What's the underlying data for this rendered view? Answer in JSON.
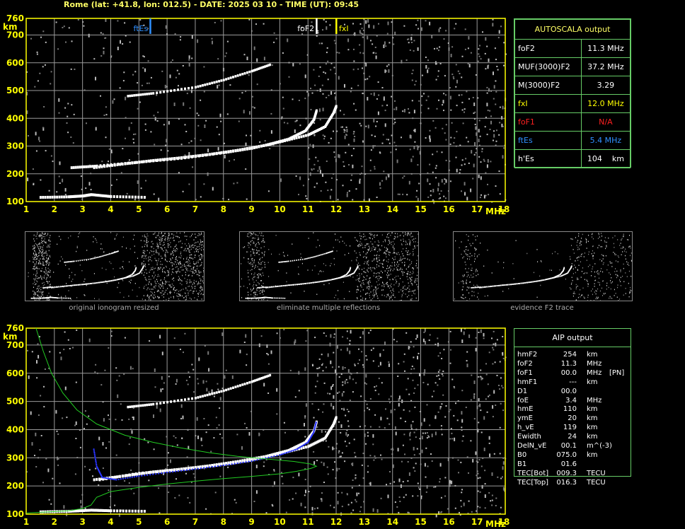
{
  "header": {
    "title": "Rome (lat: +41.8, lon: 012.5) - DATE: 2025 03 10 - TIME (UT): 09:45"
  },
  "colors": {
    "axis": "#ffff00",
    "grid": "#9a9a9a",
    "green_box": "#66cc66",
    "fxI": "#ffff00",
    "foF1": "#ff2020",
    "ftEs": "#3090ff",
    "trace_white": "#ffffff",
    "fit_blue": "#2a35ff",
    "profile_green": "#22cc22"
  },
  "chart_data": [
    {
      "type": "scatter",
      "id": "ionogram-top",
      "xlabel": "MHz",
      "ylabel": "km",
      "xlim": [
        1,
        18
      ],
      "ylim": [
        100,
        760
      ],
      "x_ticks": [
        "1",
        "2",
        "3",
        "4",
        "5",
        "6",
        "7",
        "8",
        "9",
        "10",
        "11",
        "12",
        "13",
        "14",
        "15",
        "16",
        "17",
        "18"
      ],
      "y_ticks": [
        "100",
        "200",
        "300",
        "400",
        "500",
        "600",
        "700",
        "760"
      ],
      "markers": [
        {
          "label": "ftEs",
          "x": 5.4,
          "color_key": "ftEs"
        },
        {
          "label": "foF2",
          "x": 11.3,
          "color_key": "trace_white"
        },
        {
          "label": "fxI",
          "x": 12.0,
          "color_key": "fxI"
        }
      ],
      "traces": [
        {
          "name": "Es layer",
          "points": [
            [
              1.5,
              115
            ],
            [
              2.5,
              117
            ],
            [
              3.0,
              120
            ],
            [
              3.3,
              125
            ],
            [
              4.0,
              118
            ],
            [
              5.3,
              115
            ]
          ]
        },
        {
          "name": "F2 ordinary",
          "points": [
            [
              3.4,
              222
            ],
            [
              4.5,
              236
            ],
            [
              5.5,
              248
            ],
            [
              6.5,
              258
            ],
            [
              7.5,
              270
            ],
            [
              8.5,
              285
            ],
            [
              9.5,
              303
            ],
            [
              10.3,
              325
            ],
            [
              10.9,
              355
            ],
            [
              11.2,
              395
            ],
            [
              11.3,
              430
            ]
          ]
        },
        {
          "name": "F2 extraordinary",
          "points": [
            [
              2.6,
              222
            ],
            [
              3.5,
              228
            ],
            [
              5,
              242
            ],
            [
              6.5,
              256
            ],
            [
              8,
              276
            ],
            [
              9,
              292
            ],
            [
              10,
              315
            ],
            [
              11,
              340
            ],
            [
              11.6,
              370
            ],
            [
              11.9,
              420
            ],
            [
              12.0,
              445
            ]
          ]
        },
        {
          "name": "F2 multiple echo",
          "points": [
            [
              4.6,
              480
            ],
            [
              5.5,
              490
            ],
            [
              7,
              512
            ],
            [
              8,
              538
            ],
            [
              9,
              570
            ],
            [
              9.7,
              595
            ]
          ]
        }
      ]
    },
    {
      "type": "scatter",
      "id": "ionogram-bottom",
      "xlabel": "MHz",
      "ylabel": "km",
      "xlim": [
        1,
        18
      ],
      "ylim": [
        100,
        760
      ],
      "x_ticks": [
        "1",
        "2",
        "3",
        "4",
        "5",
        "6",
        "7",
        "8",
        "9",
        "10",
        "11",
        "12",
        "13",
        "14",
        "15",
        "16",
        "17",
        "18"
      ],
      "y_ticks": [
        "100",
        "200",
        "300",
        "400",
        "500",
        "600",
        "700",
        "760"
      ],
      "traces": [
        {
          "name": "Es layer",
          "points": [
            [
              1.5,
              108
            ],
            [
              2.5,
              110
            ],
            [
              3.3,
              114
            ],
            [
              4,
              112
            ],
            [
              5.3,
              110
            ]
          ]
        },
        {
          "name": "F2 ordinary",
          "points": [
            [
              3.4,
              222
            ],
            [
              4.5,
              236
            ],
            [
              5.5,
              250
            ],
            [
              6.5,
              260
            ],
            [
              7.5,
              272
            ],
            [
              8.5,
              287
            ],
            [
              9.5,
              305
            ],
            [
              10.3,
              326
            ],
            [
              10.9,
              355
            ],
            [
              11.2,
              395
            ],
            [
              11.3,
              430
            ]
          ]
        },
        {
          "name": "F2 extraordinary",
          "points": [
            [
              3.6,
              222
            ],
            [
              5,
              245
            ],
            [
              6.5,
              258
            ],
            [
              8,
              276
            ],
            [
              9,
              292
            ],
            [
              10,
              315
            ],
            [
              11,
              340
            ],
            [
              11.6,
              370
            ],
            [
              11.9,
              420
            ],
            [
              12.0,
              445
            ]
          ]
        },
        {
          "name": "F2 multiple echo",
          "points": [
            [
              4.6,
              480
            ],
            [
              5.5,
              490
            ],
            [
              7,
              512
            ],
            [
              8,
              538
            ],
            [
              9,
              570
            ],
            [
              9.7,
              595
            ]
          ]
        }
      ],
      "fit": [
        [
          3.4,
          330
        ],
        [
          3.5,
          270
        ],
        [
          3.7,
          230
        ],
        [
          4.2,
          222
        ],
        [
          5,
          235
        ],
        [
          6,
          248
        ],
        [
          7,
          260
        ],
        [
          8,
          273
        ],
        [
          9,
          288
        ],
        [
          10,
          310
        ],
        [
          10.6,
          330
        ],
        [
          11,
          355
        ],
        [
          11.2,
          390
        ],
        [
          11.3,
          430
        ]
      ],
      "profile": [
        [
          1.0,
          104
        ],
        [
          1.8,
          108
        ],
        [
          2.5,
          112
        ],
        [
          3.0,
          120
        ],
        [
          3.3,
          132
        ],
        [
          3.5,
          160
        ],
        [
          4.0,
          180
        ],
        [
          5.0,
          195
        ],
        [
          6.0,
          207
        ],
        [
          7.0,
          217
        ],
        [
          8.0,
          226
        ],
        [
          9.0,
          234
        ],
        [
          10.0,
          243
        ],
        [
          10.6,
          252
        ],
        [
          11.1,
          262
        ],
        [
          11.3,
          270
        ],
        [
          11.1,
          278
        ],
        [
          10.5,
          287
        ],
        [
          9.5,
          296
        ],
        [
          8.5,
          305
        ],
        [
          7.5,
          318
        ],
        [
          6.5,
          335
        ],
        [
          5.5,
          355
        ],
        [
          4.5,
          380
        ],
        [
          3.5,
          420
        ],
        [
          2.8,
          470
        ],
        [
          2.3,
          530
        ],
        [
          1.9,
          600
        ],
        [
          1.6,
          680
        ],
        [
          1.35,
          760
        ]
      ]
    }
  ],
  "autoscala": {
    "title": "AUTOSCALA output",
    "rows": [
      {
        "label": "foF2",
        "value": "11.3 MHz",
        "color": "#ffffff"
      },
      {
        "label": "MUF(3000)F2",
        "value": "37.2 MHz",
        "color": "#ffffff"
      },
      {
        "label": "M(3000)F2",
        "value": "3.29",
        "color": "#ffffff"
      },
      {
        "label": "fxI",
        "value": "12.0 MHz",
        "color": "#ffff00"
      },
      {
        "label": "foF1",
        "value": "N/A",
        "color": "#ff2020"
      },
      {
        "label": "ftEs",
        "value": "5.4 MHz",
        "color": "#3090ff"
      },
      {
        "label": "h'Es",
        "value": "104    km",
        "color": "#ffffff"
      }
    ]
  },
  "thumbnails": [
    {
      "caption": "original ionogram resized"
    },
    {
      "caption": "eliminate multiple reflections"
    },
    {
      "caption": "evidence F2 trace"
    }
  ],
  "aip": {
    "title": "AIP output",
    "rows": [
      [
        "hmF2",
        "254",
        "km",
        ""
      ],
      [
        "foF2",
        "11.3",
        "MHz",
        ""
      ],
      [
        "foF1",
        "00.0",
        "MHz",
        "[PN]"
      ],
      [
        "hmF1",
        "---",
        "km",
        ""
      ],
      [
        "D1",
        "00.0",
        "",
        ""
      ],
      [
        "foE",
        "3.4",
        "MHz",
        ""
      ],
      [
        "hmE",
        "110",
        "km",
        ""
      ],
      [
        "ymE",
        "20",
        "km",
        ""
      ],
      [
        "h_vE",
        "119",
        "km",
        ""
      ],
      [
        "Ewidth",
        "24",
        "km",
        ""
      ],
      [
        "DelN_vE",
        "00.1",
        "m^(-3)",
        ""
      ],
      [
        "B0",
        "075.0",
        "km",
        ""
      ],
      [
        "B1",
        "01.6",
        "",
        ""
      ],
      [
        "TEC[Bot]",
        "009.3",
        "TECU",
        ""
      ],
      [
        "TEC[Top]",
        "016.3",
        "TECU",
        ""
      ]
    ]
  }
}
